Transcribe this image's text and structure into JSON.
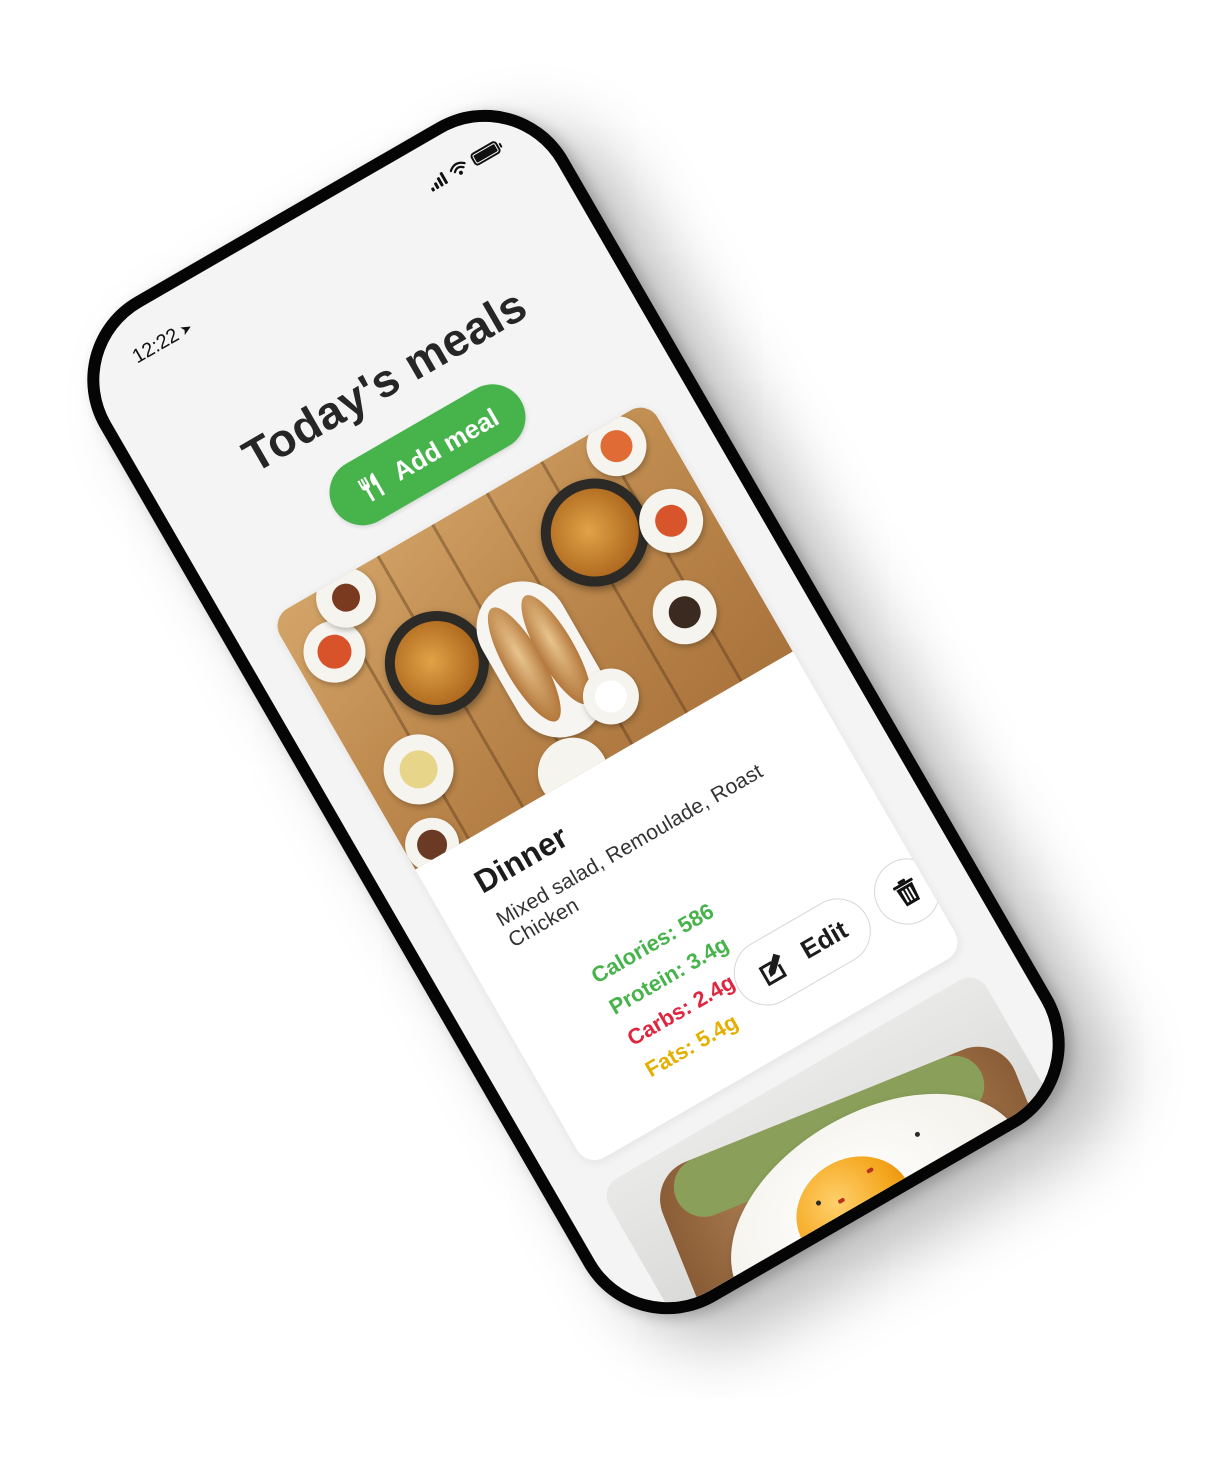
{
  "status_bar": {
    "time": "12:22",
    "location_icon": "location-arrow-icon",
    "icons": [
      "cellular-signal-icon",
      "wifi-icon",
      "battery-icon"
    ]
  },
  "header": {
    "title": "Today's meals",
    "add_button_label": "Add meal",
    "add_button_icon": "utensils-icon"
  },
  "meals": [
    {
      "name": "Dinner",
      "description": "Mixed salad, Remoulade, Roast Chicken",
      "image": "korean-table-spread-photo",
      "nutrition": {
        "calories": "Calories: 586",
        "protein": "Protein: 3.4g",
        "carbs": "Carbs: 2.4g",
        "fats": "Fats: 5.4g"
      },
      "actions": {
        "edit_label": "Edit",
        "edit_icon": "edit-icon",
        "delete_icon": "trash-icon"
      }
    },
    {
      "image": "fried-egg-toast-photo"
    }
  ],
  "colors": {
    "accent_green": "#47b34b",
    "protein_green": "#47b34b",
    "carbs_red": "#e0253f",
    "fats_yellow": "#e3b000",
    "background": "#f4f4f4"
  }
}
